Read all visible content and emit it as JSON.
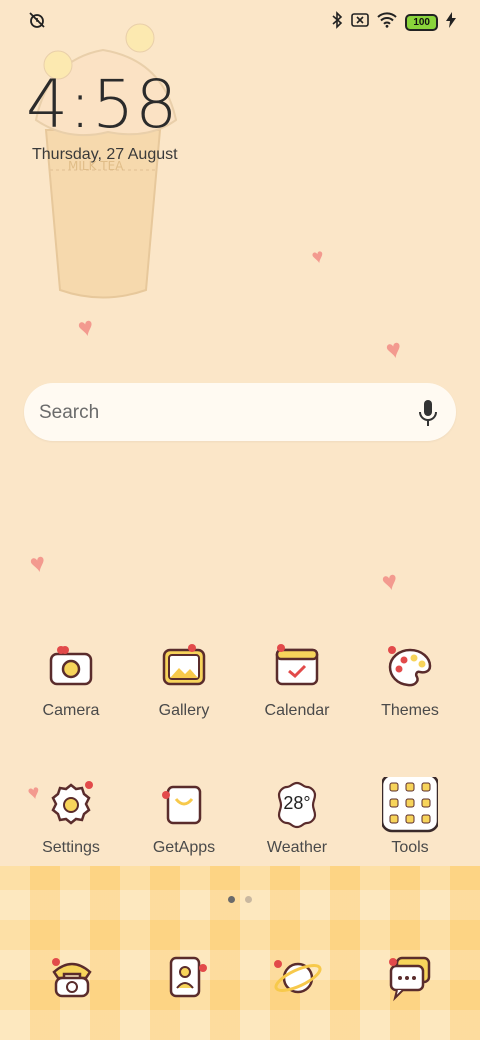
{
  "status_bar": {
    "left_icons": [
      "alarm-off-icon"
    ],
    "right_icons": [
      "bluetooth-icon",
      "sim-off-icon",
      "wifi-icon",
      "battery-icon",
      "charging-icon"
    ],
    "battery": "100"
  },
  "clock": {
    "time": "4:58",
    "date": "Thursday, 27 August"
  },
  "search": {
    "placeholder": "Search",
    "mic_icon": "mic-icon"
  },
  "apps": {
    "row1": [
      {
        "label": "Camera",
        "icon": "camera-icon"
      },
      {
        "label": "Gallery",
        "icon": "gallery-icon"
      },
      {
        "label": "Calendar",
        "icon": "calendar-icon"
      },
      {
        "label": "Themes",
        "icon": "palette-icon"
      }
    ],
    "row2": [
      {
        "label": "Settings",
        "icon": "gear-icon"
      },
      {
        "label": "GetApps",
        "icon": "shopping-bag-icon"
      },
      {
        "label": "Weather",
        "icon": "weather-icon",
        "badge": "28°"
      },
      {
        "label": "Tools",
        "icon": "folder-icon"
      }
    ]
  },
  "page_indicator": {
    "pages": 2,
    "active": 1
  },
  "dock": [
    "phone-icon",
    "contacts-icon",
    "browser-icon",
    "messages-icon"
  ],
  "colors": {
    "background": "#fbe6c8",
    "heart": "#f39a8f",
    "accent_red": "#e24a4a",
    "accent_yellow": "#f7d45b"
  }
}
